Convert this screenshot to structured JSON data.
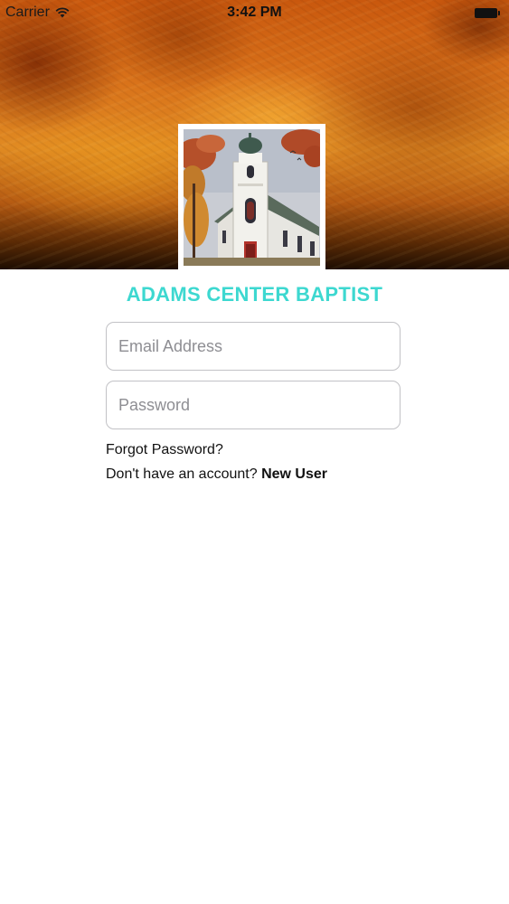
{
  "status_bar": {
    "carrier": "Carrier",
    "time": "3:42 PM",
    "wifi_icon": "wifi-icon",
    "battery_icon": "battery-icon"
  },
  "header": {
    "background": "orange-grunge-texture",
    "image": "church-painting"
  },
  "church_name": "ADAMS CENTER BAPTIST",
  "login": {
    "email_placeholder": "Email Address",
    "email_value": "",
    "password_placeholder": "Password",
    "password_value": "",
    "forgot_password": "Forgot Password?",
    "no_account_text": "Don't have an account?",
    "new_user": "New User"
  },
  "colors": {
    "accent": "#3dd8d0",
    "header_orange": "#d9721a",
    "input_border": "#c2c2c6",
    "placeholder": "#8e8e93"
  }
}
